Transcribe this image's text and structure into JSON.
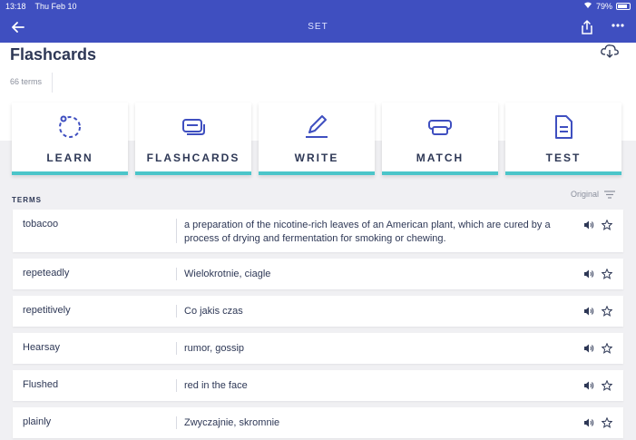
{
  "status": {
    "time": "13:18",
    "date": "Thu Feb 10",
    "battery": "79%"
  },
  "nav": {
    "title": "SET"
  },
  "header": {
    "title": "Flashcards",
    "terms_count": "66 terms"
  },
  "modes": [
    {
      "label": "LEARN",
      "icon": "learn-icon"
    },
    {
      "label": "FLASHCARDS",
      "icon": "flashcards-icon"
    },
    {
      "label": "WRITE",
      "icon": "write-icon"
    },
    {
      "label": "MATCH",
      "icon": "match-icon"
    },
    {
      "label": "TEST",
      "icon": "test-icon"
    }
  ],
  "terms_section": {
    "label": "TERMS",
    "sort": "Original"
  },
  "terms": [
    {
      "term": "tobacoo",
      "definition": "a preparation of the nicotine-rich leaves of an American plant, which are cured by a process of drying and fermentation for smoking or chewing."
    },
    {
      "term": "repeteadly",
      "definition": "Wielokrotnie, ciagle"
    },
    {
      "term": "repetitively",
      "definition": "Co jakis czas"
    },
    {
      "term": "Hearsay",
      "definition": "rumor, gossip"
    },
    {
      "term": "Flushed",
      "definition": "red in the face"
    },
    {
      "term": "plainly",
      "definition": "Zwyczajnie, skromnie"
    }
  ],
  "colors": {
    "nav": "#3f4fc0",
    "accent": "#4bc5c9",
    "text": "#2e3856"
  }
}
